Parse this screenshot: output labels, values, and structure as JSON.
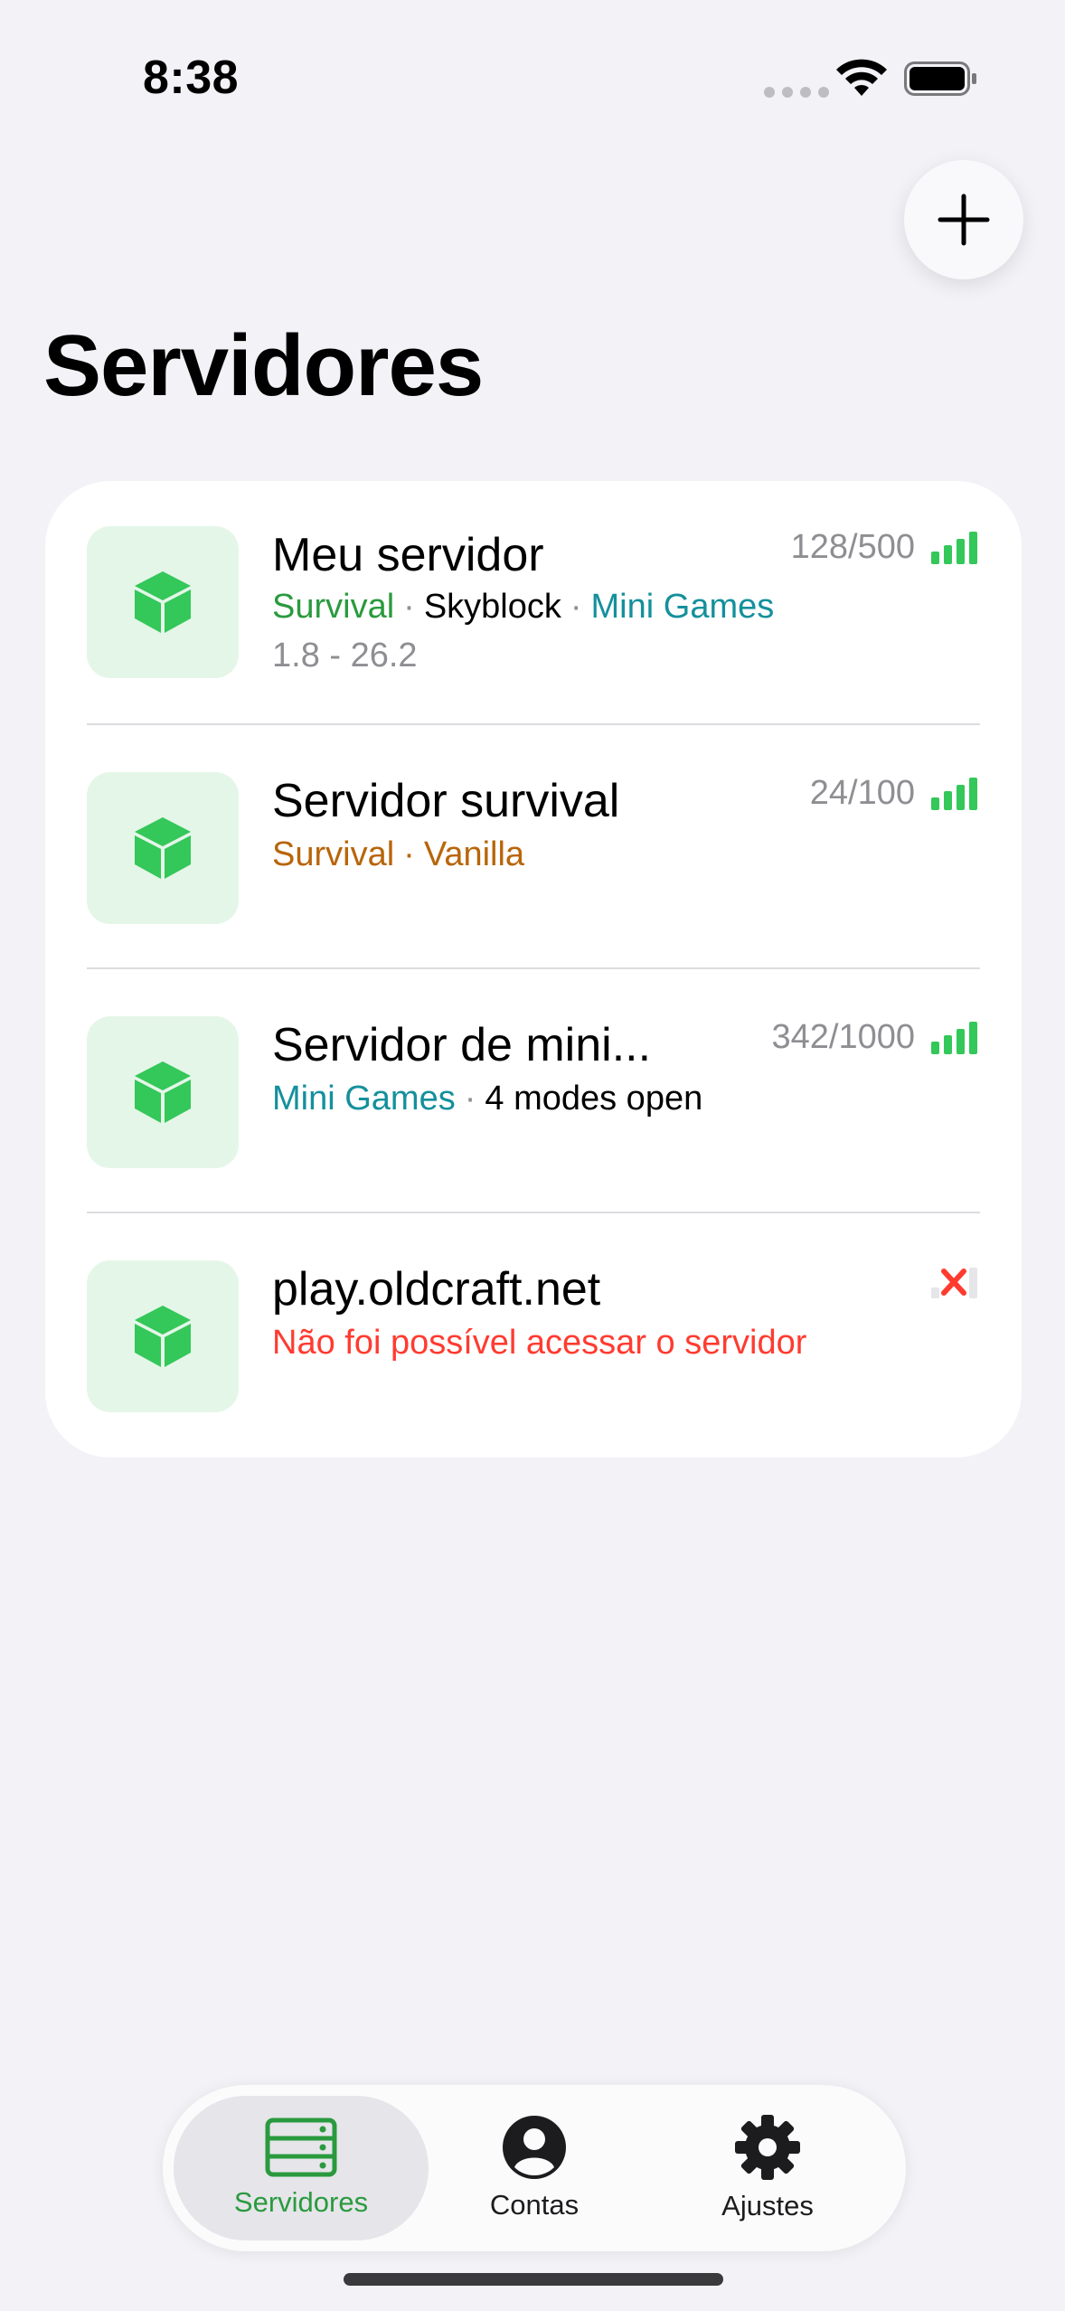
{
  "status_bar": {
    "time": "8:38"
  },
  "header": {
    "title": "Servidores"
  },
  "colors": {
    "accent_green": "#2a9a3e",
    "signal_green": "#34c759",
    "cube_green": "#34c759",
    "tag_survival": "#2a9a3e",
    "tag_minigames": "#14909c",
    "tag_orange": "#b8650a",
    "error_red": "#ff3b30"
  },
  "servers": [
    {
      "name": "Meu servidor",
      "players": "128/500",
      "tags": [
        {
          "text": "Survival",
          "color": "#2a9a3e"
        },
        {
          "text": "Skyblock",
          "color": "#000000"
        },
        {
          "text": "Mini Games",
          "color": "#14909c"
        }
      ],
      "version": "1.8 - 26.2",
      "status": "online"
    },
    {
      "name": "Servidor survival",
      "players": "24/100",
      "tags": [
        {
          "text": "Survival",
          "color": "#b8650a"
        },
        {
          "text": "Vanilla",
          "color": "#b8650a"
        }
      ],
      "status": "online"
    },
    {
      "name": "Servidor de mini...",
      "players": "342/1000",
      "tags": [
        {
          "text": "Mini Games",
          "color": "#14909c"
        },
        {
          "text": "4 modes open",
          "color": "#000000"
        }
      ],
      "status": "online"
    },
    {
      "name": "play.oldcraft.net",
      "error": "Não foi possível acessar o servidor",
      "status": "offline"
    }
  ],
  "tabbar": {
    "tabs": [
      {
        "label": "Servidores",
        "icon": "server-icon",
        "active": true
      },
      {
        "label": "Contas",
        "icon": "account-icon",
        "active": false
      },
      {
        "label": "Ajustes",
        "icon": "gear-icon",
        "active": false
      }
    ]
  }
}
